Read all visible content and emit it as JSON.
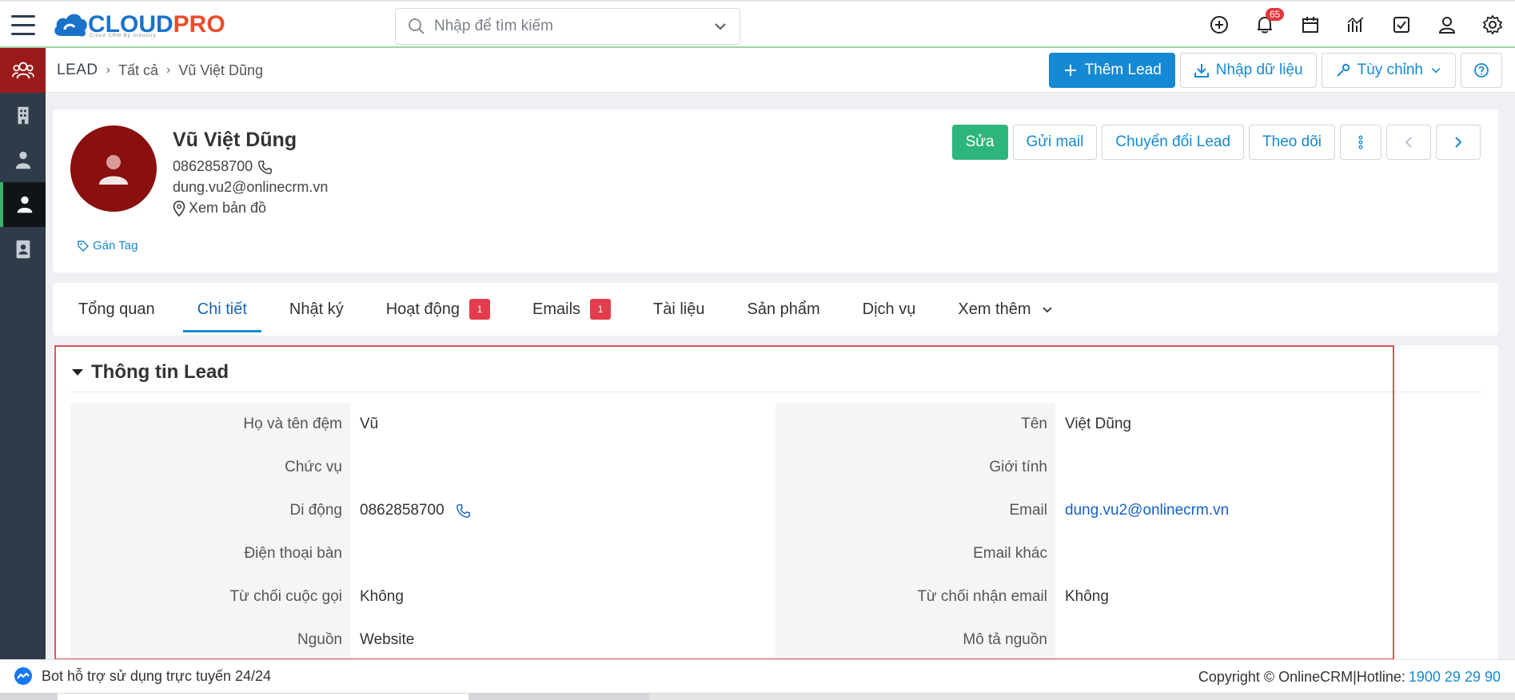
{
  "header": {
    "logo_main": "CLOUD",
    "logo_accent": "PRO",
    "logo_tagline": "Cloud CRM By Industry",
    "search_placeholder": "Nhập để tìm kiếm",
    "notification_count": "65",
    "icons": [
      "add-circle-icon",
      "bell-icon",
      "calendar-icon",
      "chart-icon",
      "checkbox-icon",
      "user-icon",
      "gear-icon"
    ]
  },
  "sidebar": {
    "items": [
      "leads-icon",
      "building-icon",
      "contact-person-icon",
      "lead-person-icon",
      "contact-card-icon"
    ]
  },
  "breadcrumb": {
    "root": "LEAD",
    "level1": "Tất cả",
    "current": "Vũ Việt Dũng"
  },
  "toolbar": {
    "add_lead": "Thêm Lead",
    "import": "Nhập dữ liệu",
    "customize": "Tùy chỉnh"
  },
  "profile": {
    "name": "Vũ Việt Dũng",
    "phone": "0862858700",
    "email": "dung.vu2@onlinecrm.vn",
    "map_link": "Xem bản đồ",
    "tag_link": "Gán Tag",
    "actions": {
      "edit": "Sửa",
      "send_mail": "Gửi mail",
      "convert": "Chuyển đổi Lead",
      "follow": "Theo dõi"
    }
  },
  "tabs": [
    {
      "label": "Tổng quan"
    },
    {
      "label": "Chi tiết",
      "active": true
    },
    {
      "label": "Nhật ký"
    },
    {
      "label": "Hoạt động",
      "badge": "1"
    },
    {
      "label": "Emails",
      "badge": "1"
    },
    {
      "label": "Tài liệu"
    },
    {
      "label": "Sản phẩm"
    },
    {
      "label": "Dịch vụ"
    },
    {
      "label": "Xem thêm"
    }
  ],
  "section": {
    "title": "Thông tin Lead",
    "left_fields": [
      {
        "label": "Họ và tên đệm",
        "value": "Vũ"
      },
      {
        "label": "Chức vụ",
        "value": ""
      },
      {
        "label": "Di động",
        "value": "0862858700"
      },
      {
        "label": "Điện thoại bàn",
        "value": ""
      },
      {
        "label": "Từ chối cuộc gọi",
        "value": "Không"
      },
      {
        "label": "Nguồn",
        "value": "Website"
      }
    ],
    "right_fields": [
      {
        "label": "Tên",
        "value": "Việt Dũng"
      },
      {
        "label": "Giới tính",
        "value": ""
      },
      {
        "label": "Email",
        "value": "dung.vu2@onlinecrm.vn"
      },
      {
        "label": "Email khác",
        "value": ""
      },
      {
        "label": "Từ chối nhận email",
        "value": "Không"
      },
      {
        "label": "Mô tả nguồn",
        "value": ""
      }
    ]
  },
  "footer": {
    "bot_text": "Bot hỗ trợ sử dụng trực tuyến 24/24",
    "copyright": "Copyright © OnlineCRM|Hotline:",
    "hotline": "1900 29 29 90"
  },
  "colors": {
    "primary": "#1689d4",
    "success": "#2eb57b",
    "danger": "#e23c4d",
    "sidebar": "#2f3b48",
    "avatar": "#8a1010"
  }
}
